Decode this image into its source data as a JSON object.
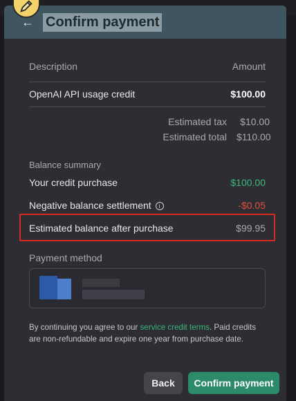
{
  "modal": {
    "title": "Confirm payment"
  },
  "table": {
    "col_description": "Description",
    "col_amount": "Amount",
    "item_label": "OpenAI API usage credit",
    "item_amount": "$100.00",
    "tax_label": "Estimated tax",
    "tax_value": "$10.00",
    "total_label": "Estimated total",
    "total_value": "$110.00"
  },
  "balance": {
    "title": "Balance summary",
    "credit_label": "Your credit purchase",
    "credit_value": "$100.00",
    "negative_label": "Negative balance settlement",
    "negative_value": "-$0.05",
    "estimated_label": "Estimated balance after purchase",
    "estimated_value": "$99.95"
  },
  "payment": {
    "title": "Payment method"
  },
  "terms": {
    "prefix": "By continuing you agree to our ",
    "link": "service credit terms",
    "suffix": ". Paid credits are non-refundable and expire one year from purchase date."
  },
  "buttons": {
    "back": "Back",
    "confirm": "Confirm payment"
  },
  "colors": {
    "accent_green": "#3bb87e",
    "negative_red": "#e0503f",
    "confirm_button": "#2c8a68",
    "highlight_border": "#d92a1f"
  }
}
